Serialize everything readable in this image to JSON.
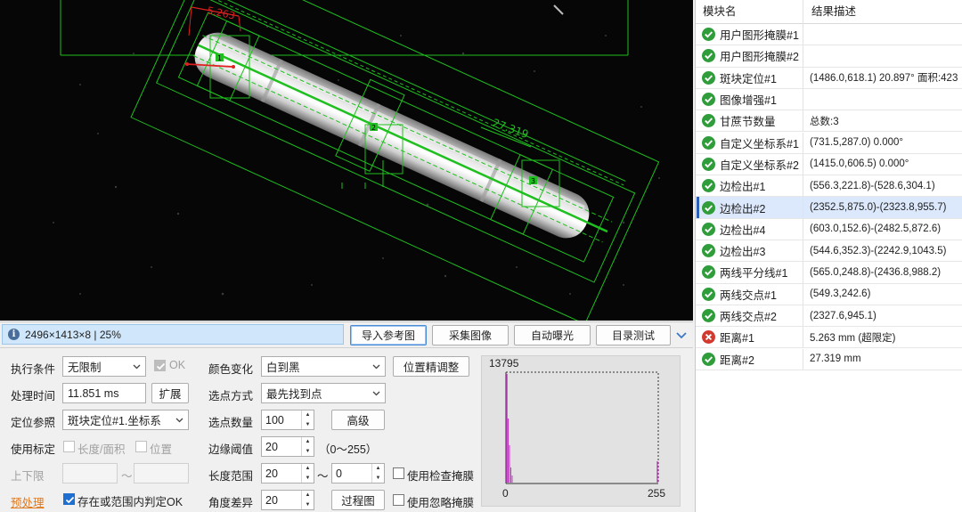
{
  "viewer": {
    "measure_red": "5.263",
    "measure_green": "27.319",
    "markers": [
      "1",
      "2",
      "3"
    ]
  },
  "info": {
    "text": "2496×1413×8 | 25%"
  },
  "toolbar": {
    "import_ref": "导入参考图",
    "capture": "采集图像",
    "auto_exposure": "自动曝光",
    "dir_test": "目录测试"
  },
  "settings": {
    "exec_cond_label": "执行条件",
    "exec_cond_value": "无限制",
    "ok_label": "OK",
    "proc_time_label": "处理时间",
    "proc_time_value": "11.851 ms",
    "expand_btn": "扩展",
    "pos_ref_label": "定位参照",
    "pos_ref_value": "斑块定位#1.坐标系",
    "use_calib_label": "使用标定",
    "len_area_label": "长度/面积",
    "position_label": "位置",
    "limit_label": "上下限",
    "tilde": "～",
    "preproc_link": "预处理",
    "exist_ok_label": "存在或范围内判定OK",
    "color_change_label": "颜色变化",
    "color_change_value": "白到黑",
    "pos_adjust_btn": "位置精调整",
    "select_mode_label": "选点方式",
    "select_mode_value": "最先找到点",
    "point_count_label": "选点数量",
    "point_count_value": "100",
    "advanced_btn": "高级",
    "edge_thresh_label": "边缘阈值",
    "edge_thresh_value": "20",
    "edge_thresh_range": "（0～255）",
    "len_range_label": "长度范围",
    "len_min": "20",
    "len_tilde": "～",
    "len_max": "0",
    "use_check_mask": "使用检查掩膜",
    "angle_diff_label": "角度差异",
    "angle_diff_value": "20",
    "process_btn": "过程图",
    "use_ignore_mask": "使用忽略掩膜"
  },
  "histogram": {
    "max_label": "13795",
    "x_min": "0",
    "x_max": "255"
  },
  "results": {
    "col_module": "模块名",
    "col_desc": "结果描述",
    "rows": [
      {
        "name": "用户图形掩膜#1",
        "desc": "",
        "status": "ok"
      },
      {
        "name": "用户图形掩膜#2",
        "desc": "",
        "status": "ok"
      },
      {
        "name": "斑块定位#1",
        "desc": "(1486.0,618.1) 20.897° 面积:423",
        "status": "ok"
      },
      {
        "name": "图像增强#1",
        "desc": "",
        "status": "ok"
      },
      {
        "name": "甘蔗节数量",
        "desc": "总数:3",
        "status": "ok"
      },
      {
        "name": "自定义坐标系#1",
        "desc": "(731.5,287.0) 0.000°",
        "status": "ok"
      },
      {
        "name": "自定义坐标系#2",
        "desc": "(1415.0,606.5) 0.000°",
        "status": "ok"
      },
      {
        "name": "边检出#1",
        "desc": "(556.3,221.8)-(528.6,304.1)",
        "status": "ok"
      },
      {
        "name": "边检出#2",
        "desc": "(2352.5,875.0)-(2323.8,955.7)",
        "status": "ok"
      },
      {
        "name": "边检出#4",
        "desc": "(603.0,152.6)-(2482.5,872.6)",
        "status": "ok"
      },
      {
        "name": "边检出#3",
        "desc": "(544.6,352.3)-(2242.9,1043.5)",
        "status": "ok"
      },
      {
        "name": "两线平分线#1",
        "desc": "(565.0,248.8)-(2436.8,988.2)",
        "status": "ok"
      },
      {
        "name": "两线交点#1",
        "desc": "(549.3,242.6)",
        "status": "ok"
      },
      {
        "name": "两线交点#2",
        "desc": "(2327.6,945.1)",
        "status": "ok"
      },
      {
        "name": "距离#1",
        "desc": "5.263 mm (超限定)",
        "status": "error"
      },
      {
        "name": "距离#2",
        "desc": "27.319 mm",
        "status": "ok"
      }
    ],
    "selected_index": 8
  },
  "colors": {
    "ok": "#2e9d3a",
    "error": "#d23a2f",
    "overlay_green": "#1fbf1f",
    "overlay_red": "#e02020",
    "selected_row": "#dce8fb"
  }
}
